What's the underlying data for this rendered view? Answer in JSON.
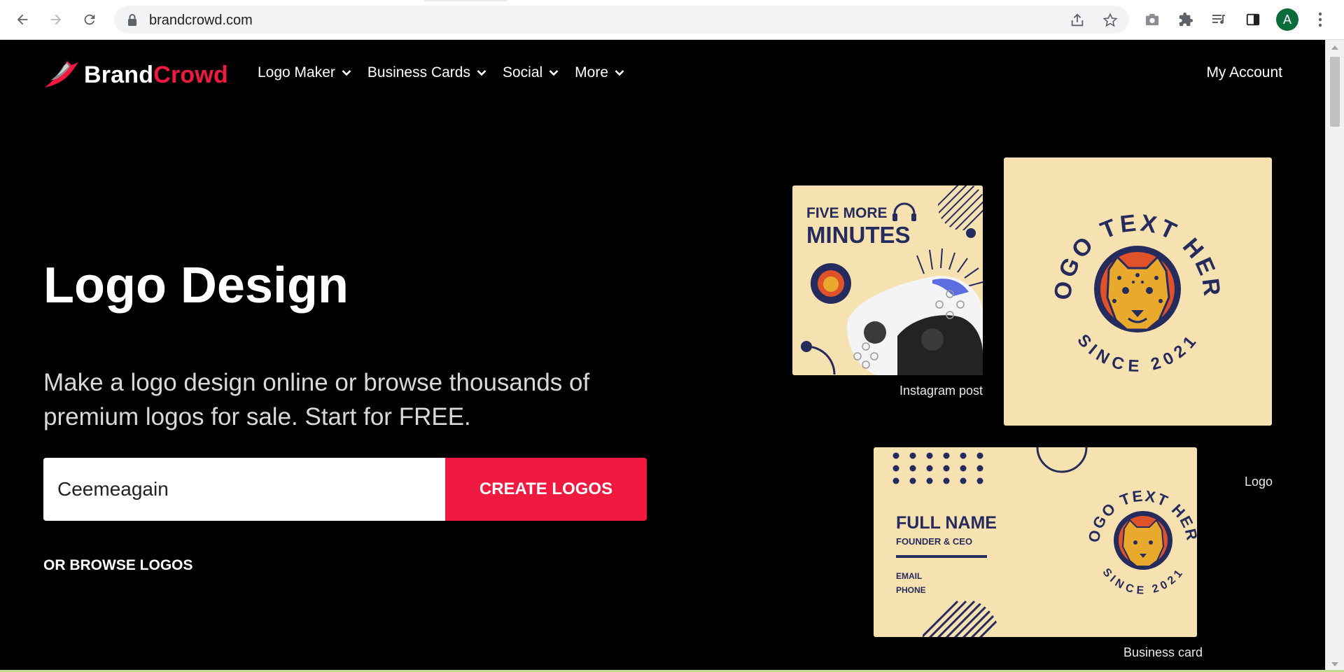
{
  "browser": {
    "url": "brandcrowd.com",
    "avatar_initial": "A"
  },
  "header": {
    "brand_part1": "Brand",
    "brand_part2": "Crowd",
    "nav": [
      {
        "label": "Logo Maker"
      },
      {
        "label": "Business Cards"
      },
      {
        "label": "Social"
      },
      {
        "label": "More"
      }
    ],
    "account": "My Account"
  },
  "hero": {
    "title": "Logo Design",
    "subtitle": "Make a logo design online or browse thousands of premium logos for sale. Start for FREE.",
    "input_value": "Ceemeagain",
    "cta": "CREATE LOGOS",
    "browse": "OR BROWSE LOGOS"
  },
  "samples": {
    "instagram": {
      "headline1": "FIVE MORE",
      "headline2": "MINUTES",
      "caption": "Instagram post"
    },
    "logo": {
      "top_text": "LOGO TEXT HERE",
      "bottom_text": "SINCE 2021",
      "caption": "Logo"
    },
    "business_card": {
      "name": "FULL NAME",
      "role": "FOUNDER & CEO",
      "email": "EMAIL",
      "phone": "PHONE",
      "caption": "Business card"
    }
  },
  "colors": {
    "accent": "#f0193f",
    "card_bg": "#f6e2b0",
    "navy": "#262b5e",
    "orange": "#e0522a",
    "gold": "#e8a92c"
  }
}
